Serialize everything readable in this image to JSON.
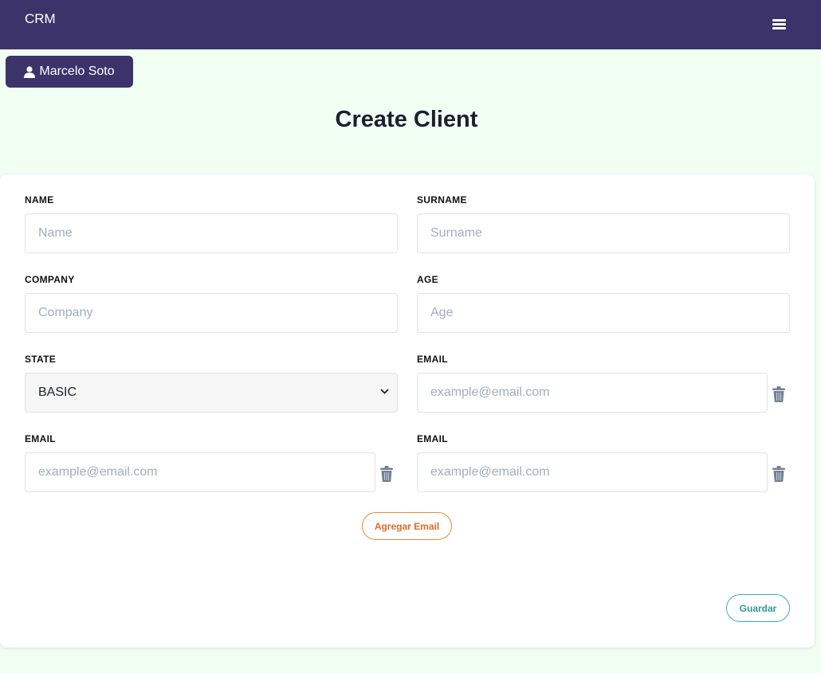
{
  "app": {
    "title": "CRM"
  },
  "user": {
    "name": "Marcelo Soto"
  },
  "page": {
    "title": "Create Client"
  },
  "form": {
    "name": {
      "label": "NAME",
      "placeholder": "Name",
      "value": ""
    },
    "surname": {
      "label": "SURNAME",
      "placeholder": "Surname",
      "value": ""
    },
    "company": {
      "label": "COMPANY",
      "placeholder": "Company",
      "value": ""
    },
    "age": {
      "label": "AGE",
      "placeholder": "Age",
      "value": ""
    },
    "state": {
      "label": "STATE",
      "selected": "BASIC"
    },
    "emails": [
      {
        "label": "EMAIL",
        "placeholder": "example@email.com",
        "value": ""
      },
      {
        "label": "EMAIL",
        "placeholder": "example@email.com",
        "value": ""
      },
      {
        "label": "EMAIL",
        "placeholder": "example@email.com",
        "value": ""
      }
    ],
    "add_email_label": "Agregar Email",
    "save_label": "Guardar"
  },
  "icons": {
    "menu": "hamburger-menu-icon",
    "user": "user-icon",
    "select": "chevron-down-icon",
    "delete": "trash-icon"
  },
  "colors": {
    "header": "#3c336b",
    "background": "#f0fff2",
    "add_email": "#dd6b20",
    "save": "#319795",
    "trash": "#718096"
  }
}
